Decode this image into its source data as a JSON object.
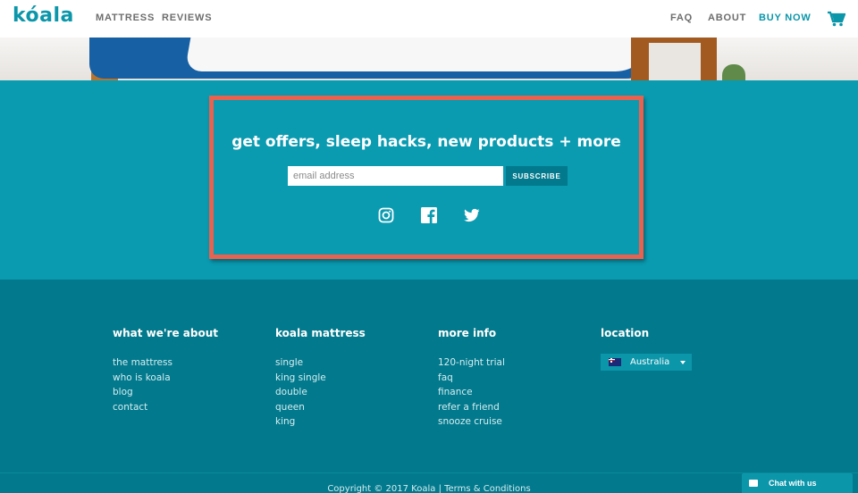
{
  "header": {
    "logo": "kóala",
    "nav_left": [
      "MATTRESS",
      "REVIEWS"
    ],
    "nav_right": [
      "FAQ",
      "ABOUT",
      "BUY NOW"
    ]
  },
  "icons": {
    "cart": "shopping-cart-icon",
    "social": [
      "instagram-icon",
      "facebook-icon",
      "twitter-icon"
    ],
    "chat": "envelope-icon",
    "flag": "australia-flag-icon"
  },
  "signup": {
    "title": "get offers, sleep hacks, new products + more",
    "email_placeholder": "email address",
    "subscribe_label": "SUBSCRIBE"
  },
  "footer": {
    "columns": [
      {
        "title": "what we're about",
        "links": [
          "the mattress",
          "who is koala",
          "blog",
          "contact"
        ]
      },
      {
        "title": "koala mattress",
        "links": [
          "single",
          "king single",
          "double",
          "queen",
          "king"
        ]
      },
      {
        "title": "more info",
        "links": [
          "120-night trial",
          "faq",
          "finance",
          "refer a friend",
          "snooze cruise"
        ]
      },
      {
        "title": "location"
      }
    ],
    "locale": "Australia",
    "copyright": "Copyright © 2017 Koala | Terms & Conditions"
  },
  "chat": {
    "label": "Chat with us"
  },
  "colors": {
    "brand": "#0b96aa",
    "band": "#0a9bb1",
    "footer": "#02798c",
    "highlight": "#e9624f"
  }
}
